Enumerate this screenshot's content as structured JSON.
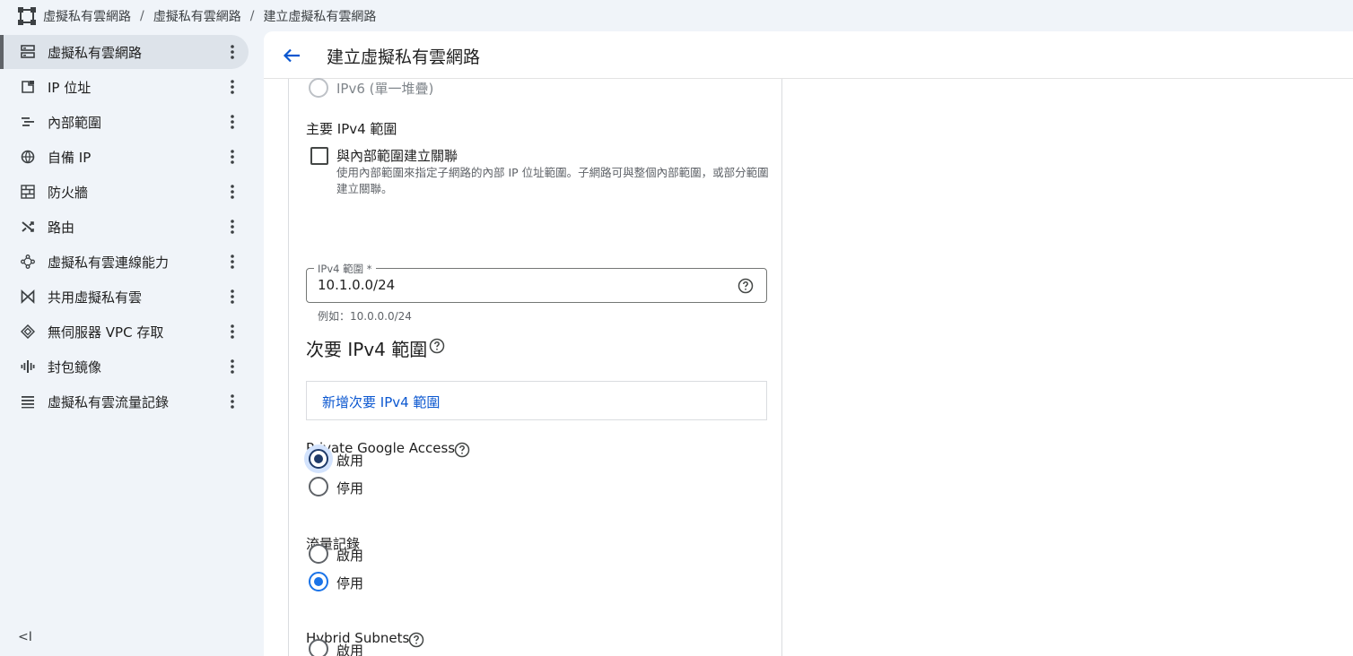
{
  "breadcrumb": {
    "items": [
      "虛擬私有雲網路",
      "虛擬私有雲網路",
      "建立虛擬私有雲網路"
    ]
  },
  "sidebar": {
    "items": [
      {
        "label": "虛擬私有雲網路",
        "icon": "vpc-network-icon"
      },
      {
        "label": "IP 位址",
        "icon": "ip-address-icon"
      },
      {
        "label": "內部範圍",
        "icon": "internal-ranges-icon"
      },
      {
        "label": "自備 IP",
        "icon": "byoip-globe-icon"
      },
      {
        "label": "防火牆",
        "icon": "firewall-icon"
      },
      {
        "label": "路由",
        "icon": "routes-icon"
      },
      {
        "label": "虛擬私有雲連線能力",
        "icon": "connectivity-icon"
      },
      {
        "label": "共用虛擬私有雲",
        "icon": "shared-vpc-icon"
      },
      {
        "label": "無伺服器 VPC 存取",
        "icon": "serverless-icon"
      },
      {
        "label": "封包鏡像",
        "icon": "packet-mirroring-icon"
      },
      {
        "label": "虛擬私有雲流量記錄",
        "icon": "flow-logs-icon"
      }
    ],
    "collapse_label": "<I"
  },
  "header": {
    "title": "建立虛擬私有雲網路"
  },
  "form": {
    "ipv6_option": "IPv6 (單一堆疊)",
    "primary_ipv4_label": "主要 IPv4 範圍",
    "associate_checkbox_label": "與內部範圍建立關聯",
    "associate_description": "使用內部範圍來指定子網路的內部 IP 位址範圍。子網路可與整個內部範圍，或部分範圍建立關聯。",
    "ipv4_range_label": "IPv4 範圍 *",
    "ipv4_range_value": "10.1.0.0/24",
    "ipv4_range_hint": "例如：10.0.0.0/24",
    "secondary_title": "次要 IPv4 範圍",
    "add_secondary_link": "新增次要 IPv4 範圍",
    "private_google_access_label": "Private Google Access",
    "flow_logs_label": "流量記錄",
    "hybrid_subnets_label": "Hybrid Subnets",
    "enable_label": "啟用",
    "disable_label": "停用",
    "private_google_access_value": "啟用",
    "flow_logs_value": "停用",
    "hybrid_subnets_value": "停用"
  },
  "colors": {
    "accent": "#1a73e8",
    "link": "#0b57d0",
    "sidebar_bg": "#f0f4f9",
    "active_item_bg": "#dde3ea"
  }
}
